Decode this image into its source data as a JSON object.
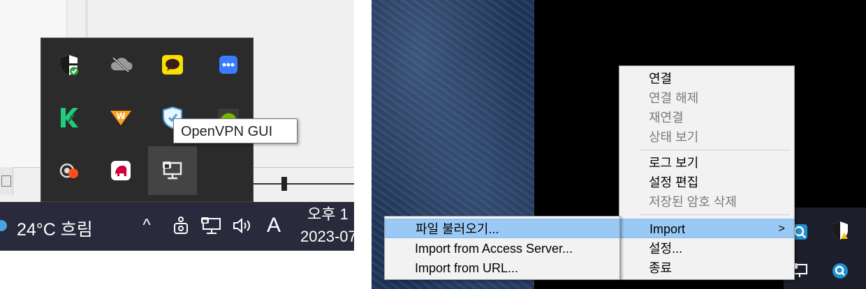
{
  "tooltip": "OpenVPN GUI",
  "taskbar": {
    "weather": "24°C  흐림",
    "clock_line1": "오후 1",
    "clock_line2": "2023-07",
    "ime": "A",
    "chevron": "^"
  },
  "overflow_icons": [
    "windows-security-icon",
    "onedrive-icon",
    "kakaotalk-icon",
    "messenger-dots-icon",
    "vue-k-icon",
    "w-app-icon",
    "shield-vpn-icon",
    "nvidia-icon",
    "camera-record-icon",
    "evernote-icon",
    "openvpn-network-icon"
  ],
  "main_menu": {
    "items": [
      {
        "label": "연결",
        "enabled": true
      },
      {
        "label": "연결 해제",
        "enabled": false
      },
      {
        "label": "재연결",
        "enabled": false
      },
      {
        "label": "상태 보기",
        "enabled": false
      },
      {
        "label": "로그 보기",
        "enabled": true
      },
      {
        "label": "설정 편집",
        "enabled": true
      },
      {
        "label": "저장된 암호 삭제",
        "enabled": false
      },
      {
        "label": "Import",
        "enabled": true,
        "submenu": true
      },
      {
        "label": "설정...",
        "enabled": true
      },
      {
        "label": "종료",
        "enabled": true
      }
    ],
    "submenu_arrow": ">"
  },
  "import_submenu": {
    "items": [
      {
        "label": "파일 불러오기..."
      },
      {
        "label": "Import from Access Server..."
      },
      {
        "label": "Import from URL..."
      }
    ]
  },
  "colors": {
    "highlight": "#99c9f4",
    "menu_bg": "#f2f2f2",
    "taskbar": "#2a2a3d",
    "overflow_bg": "#2b2b2b"
  }
}
